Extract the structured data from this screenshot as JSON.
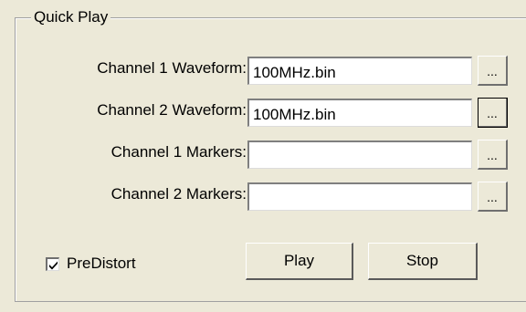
{
  "groupbox": {
    "title": "Quick Play"
  },
  "rows": [
    {
      "label": "Channel 1 Waveform:",
      "value": "100MHz.bin",
      "browse_label": "..."
    },
    {
      "label": "Channel 2 Waveform:",
      "value": "100MHz.bin",
      "browse_label": "..."
    },
    {
      "label": "Channel 1 Markers:",
      "value": "",
      "browse_label": "..."
    },
    {
      "label": "Channel 2 Markers:",
      "value": "",
      "browse_label": "..."
    }
  ],
  "predistort": {
    "label": "PreDistort",
    "checked": true
  },
  "buttons": {
    "play_label": "Play",
    "stop_label": "Stop"
  }
}
